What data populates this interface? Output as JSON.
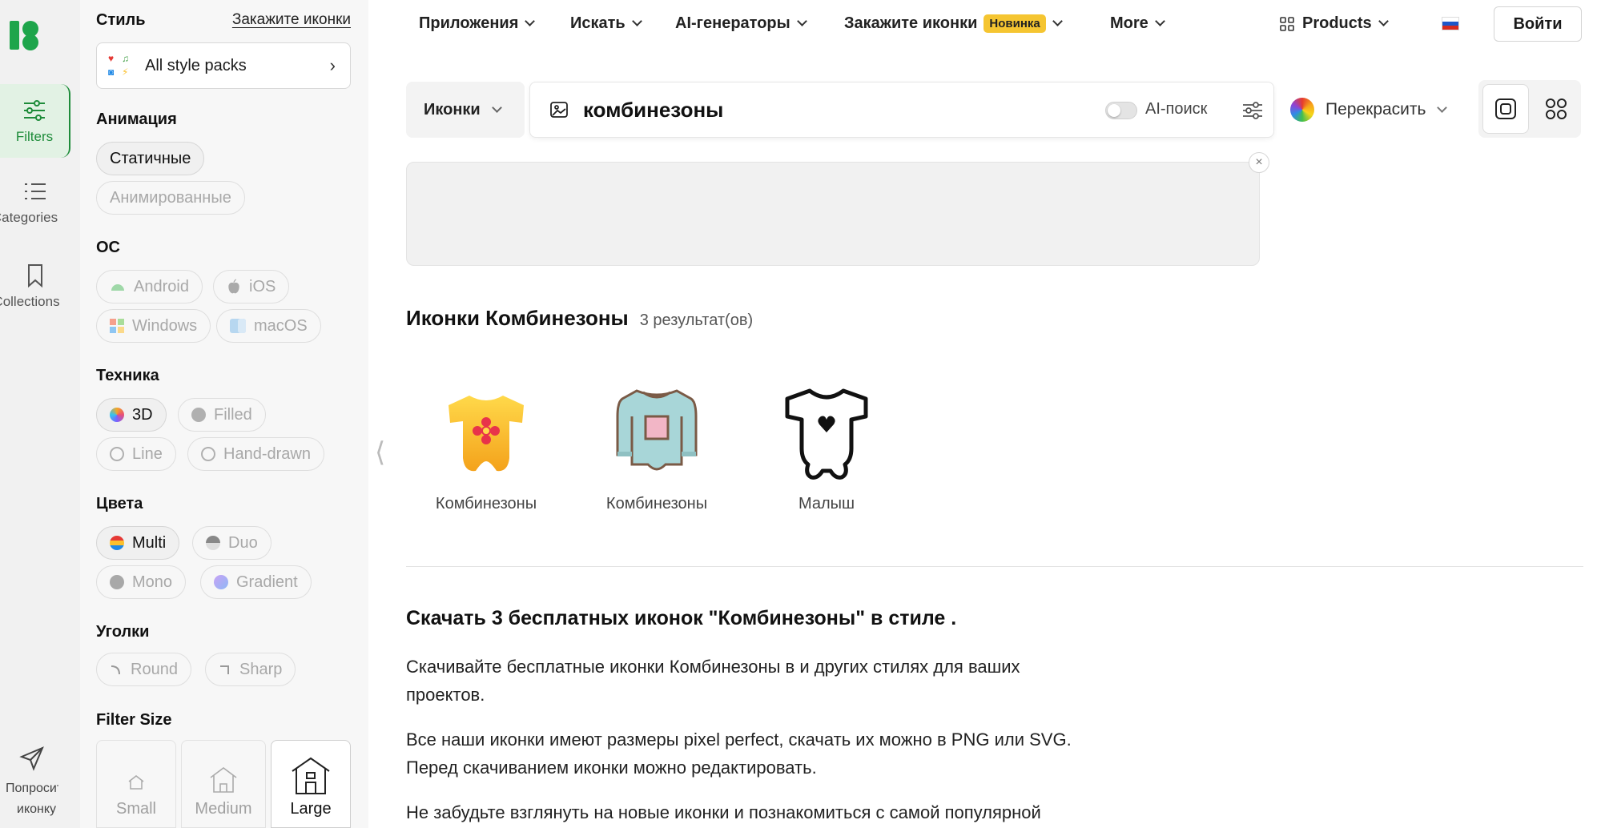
{
  "rail": {
    "items": [
      {
        "label": "Filters",
        "icon": "sliders-icon"
      },
      {
        "label": "Categories",
        "icon": "list-icon"
      },
      {
        "label": "Collections",
        "icon": "bookmark-icon"
      }
    ],
    "bottom_label": "Попросить иконку"
  },
  "filters": {
    "style_title": "Стиль",
    "order_link": "Закажите иконки",
    "style_pack": "All style packs",
    "animation": {
      "title": "Анимация",
      "options": [
        "Статичные",
        "Анимированные"
      ],
      "selected": "Статичные"
    },
    "os": {
      "title": "ОС",
      "options": [
        "Android",
        "iOS",
        "Windows",
        "macOS"
      ]
    },
    "technique": {
      "title": "Техника",
      "options": [
        "3D",
        "Filled",
        "Line",
        "Hand-drawn"
      ],
      "selected": "3D"
    },
    "colors": {
      "title": "Цвета",
      "options": [
        "Multi",
        "Duo",
        "Mono",
        "Gradient"
      ],
      "selected": "Multi"
    },
    "corners": {
      "title": "Уголки",
      "options": [
        "Round",
        "Sharp"
      ]
    },
    "size": {
      "title": "Filter Size",
      "options": [
        "Small",
        "Medium",
        "Large"
      ],
      "selected": "Large"
    }
  },
  "nav": {
    "apps": "Приложения",
    "search": "Искать",
    "ai": "AI-генераторы",
    "order": "Закажите иконки",
    "order_badge": "Новинка",
    "more": "More",
    "products": "Products",
    "login": "Войти"
  },
  "search": {
    "type": "Иконки",
    "query": "комбинезоны",
    "ai_toggle": "AI-поиск",
    "ai_enabled": false,
    "recolor": "Перекрасить"
  },
  "results": {
    "title": "Иконки Комбинезоны",
    "count": "3 результат(ов)",
    "items": [
      {
        "caption": "Комбинезоны",
        "icon": "yellow-onesie-flower-icon"
      },
      {
        "caption": "Комбинезоны",
        "icon": "blue-longsleeve-onesie-icon"
      },
      {
        "caption": "Малыш",
        "icon": "outline-onesie-heart-icon"
      }
    ]
  },
  "description": {
    "title": "Скачать 3 бесплатных иконок \"Комбинезоны\" в стиле .",
    "p1a": "Скачивайте бесплатные иконки Комбинезоны в и других стилях для ваших",
    "p1b": "проектов.",
    "p2a": "Все наши иконки имеют размеры pixel perfect, скачать их можно в PNG или SVG.",
    "p2b": "Перед скачиванием иконки можно редактировать.",
    "p3": "Не забудьте взглянуть на новые иконки и познакомиться с самой популярной"
  },
  "colors": {
    "accent": "#1e8c3a",
    "badge": "#f5c531"
  }
}
